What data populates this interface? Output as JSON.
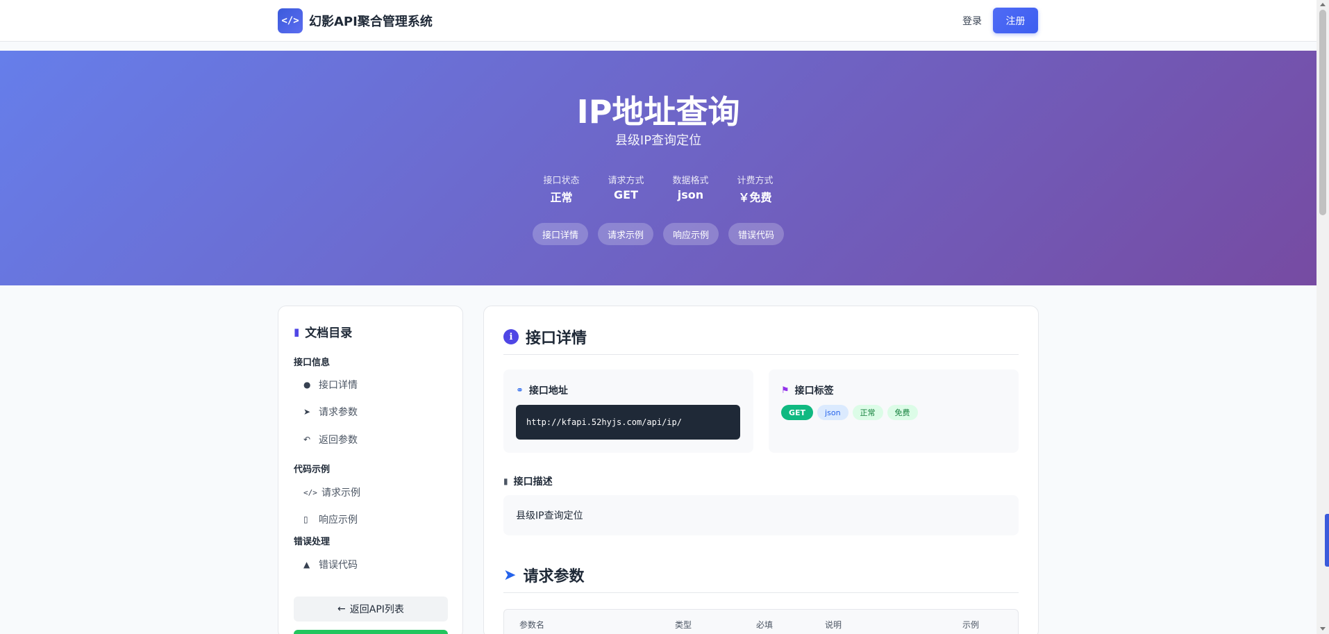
{
  "navbar": {
    "logo_symbol": "</>",
    "brand_name": "幻影API聚合管理系统",
    "login_label": "登录",
    "register_label": "注册"
  },
  "hero": {
    "title": "IP地址查询",
    "subtitle": "县级IP查询定位",
    "meta": [
      {
        "label": "接口状态",
        "value": "正常"
      },
      {
        "label": "请求方式",
        "value": "GET"
      },
      {
        "label": "数据格式",
        "value": "json"
      },
      {
        "label": "计费方式",
        "value": "￥免费"
      }
    ],
    "tabs": [
      "接口详情",
      "请求示例",
      "响应示例",
      "错误代码"
    ]
  },
  "sidebar": {
    "title": "文档目录",
    "groups": [
      {
        "label": "接口信息",
        "items": [
          {
            "label": "接口详情",
            "icon": "info-circle-icon"
          },
          {
            "label": "请求参数",
            "icon": "paper-plane-icon"
          },
          {
            "label": "返回参数",
            "icon": "reply-icon"
          }
        ]
      },
      {
        "label": "代码示例",
        "items": [
          {
            "label": "请求示例",
            "icon": "code-icon"
          },
          {
            "label": "响应示例",
            "icon": "file-code-icon"
          }
        ]
      },
      {
        "label": "错误处理",
        "items": [
          {
            "label": "错误代码",
            "icon": "warning-triangle-icon"
          }
        ]
      }
    ],
    "back_button_label": "返回API列表"
  },
  "main": {
    "details_title": "接口详情",
    "endpoint_card": {
      "title": "接口地址",
      "url": "http://kfapi.52hyjs.com/api/ip/"
    },
    "tags_card": {
      "title": "接口标签",
      "tags": [
        "GET",
        "json",
        "正常",
        "免费"
      ]
    },
    "description_label": "接口描述",
    "description_text": "县级IP查询定位",
    "params_title": "请求参数",
    "params_table": {
      "headers": [
        "参数名",
        "类型",
        "必填",
        "说明",
        "示例"
      ]
    }
  },
  "colors": {
    "hero_gradient_start": "#667eea",
    "hero_gradient_end": "#764ba2",
    "accent": "#4f46e5",
    "get_tag": "#10b981",
    "code_bg": "#1f2937"
  }
}
